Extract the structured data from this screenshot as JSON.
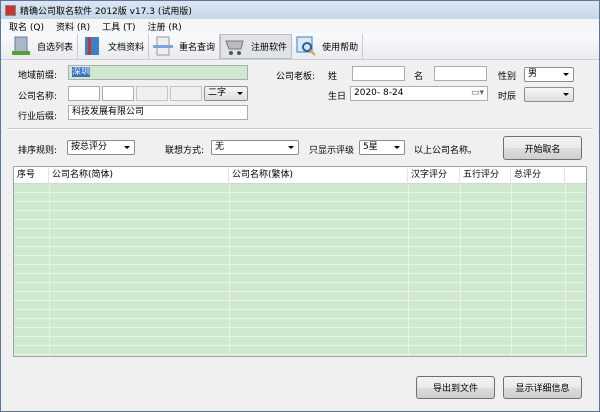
{
  "window": {
    "title": "精确公司取名软件 2012版 v17.3 (试用版)"
  },
  "menu": [
    "取名 (Q)",
    "资料 (R)",
    "工具 (T)",
    "注册 (R)"
  ],
  "toolbar": [
    {
      "label": "自选列表",
      "icon": "building-icon"
    },
    {
      "label": "文档资料",
      "icon": "book-icon"
    },
    {
      "label": "重名查询",
      "icon": "document-icon"
    },
    {
      "label": "注册软件",
      "icon": "cart-icon"
    },
    {
      "label": "使用帮助",
      "icon": "help-magnifier-icon"
    }
  ],
  "form": {
    "region_label": "地域前缀:",
    "region_value": "深圳",
    "name_label": "公司名称:",
    "name_len": "二字",
    "industry_label": "行业后缀:",
    "industry_value": "科技发展有限公司",
    "boss_label": "公司老板:",
    "surname_label": "姓",
    "given_label": "名",
    "gender_label": "性别",
    "gender_value": "男",
    "birthday_label": "生日",
    "birthday_value": "2020- 8-24",
    "hour_label": "时辰",
    "hour_value": ""
  },
  "options": {
    "sort_label": "排序规则:",
    "sort_value": "按总评分",
    "assoc_label": "联想方式:",
    "assoc_value": "无",
    "rating_label": "只显示评级",
    "rating_value": "5星",
    "rating_suffix": "以上公司名称。",
    "start_button": "开始取名"
  },
  "table": {
    "columns": [
      "序号",
      "公司名称(简体)",
      "公司名称(繁体)",
      "汉字评分",
      "五行评分",
      "总评分"
    ],
    "rows": []
  },
  "footer": {
    "export_button": "导出到文件",
    "detail_button": "显示详细信息"
  }
}
